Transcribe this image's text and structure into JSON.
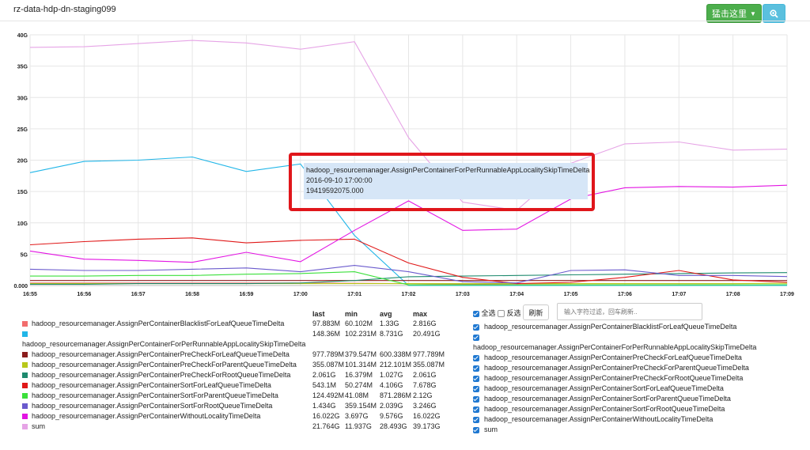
{
  "header": {
    "hostname": "rz-data-hdp-dn-staging099",
    "action_label": "猛击这里",
    "zoom_icon": "zoom-in-icon"
  },
  "chart_data": {
    "type": "line",
    "x": [
      "16:55",
      "16:56",
      "16:57",
      "16:58",
      "16:59",
      "17:00",
      "17:01",
      "17:02",
      "17:03",
      "17:04",
      "17:05",
      "17:06",
      "17:07",
      "17:08",
      "17:09"
    ],
    "y_ticks": [
      "0.000",
      "5G",
      "10G",
      "15G",
      "20G",
      "25G",
      "30G",
      "35G",
      "40G"
    ],
    "ylim": [
      0,
      40
    ],
    "y_unit": "G",
    "grid": true,
    "series": [
      {
        "name": "hadoop_resourcemanager.AssignPerContainerBlacklistForLeafQueueTimeDelta",
        "color": "#f26d6d",
        "values": [
          0.4,
          0.4,
          0.4,
          0.4,
          0.4,
          0.4,
          0.35,
          0.3,
          0.2,
          0.15,
          0.1,
          0.1,
          0.12,
          0.1,
          0.1
        ]
      },
      {
        "name": "hadoop_resourcemanager.AssignPerContainerForPerRunnableAppLocalitySkipTimeDelta",
        "color": "#21b6e8",
        "values": [
          18,
          19.8,
          20,
          20.5,
          18.2,
          19.4,
          8,
          0,
          0,
          0,
          0,
          0,
          0,
          0,
          0
        ]
      },
      {
        "name": "hadoop_resourcemanager.AssignPerContainerPreCheckForLeafQueueTimeDelta",
        "color": "#8b1c1c",
        "values": [
          0.8,
          0.8,
          0.8,
          0.8,
          0.8,
          0.8,
          0.8,
          0.8,
          0.8,
          0.8,
          0.8,
          0.8,
          0.8,
          0.8,
          0.8
        ]
      },
      {
        "name": "hadoop_resourcemanager.AssignPerContainerPreCheckForParentQueueTimeDelta",
        "color": "#b8c81a",
        "values": [
          0.3,
          0.3,
          0.3,
          0.3,
          0.3,
          0.3,
          0.3,
          0.3,
          0.3,
          0.3,
          0.3,
          0.3,
          0.3,
          0.3,
          0.35
        ]
      },
      {
        "name": "hadoop_resourcemanager.AssignPerContainerPreCheckForRootQueueTimeDelta",
        "color": "#1e8a6e",
        "values": [
          0.2,
          0.2,
          0.3,
          0.3,
          0.3,
          0.4,
          0.8,
          1.4,
          1.5,
          1.6,
          1.7,
          1.8,
          1.9,
          2,
          2.06
        ]
      },
      {
        "name": "hadoop_resourcemanager.AssignPerContainerSortForLeafQueueTimeDelta",
        "color": "#e01818",
        "values": [
          6.5,
          7,
          7.4,
          7.6,
          6.8,
          7.2,
          7.4,
          3.6,
          1.3,
          0.3,
          0.5,
          1.3,
          2.4,
          0.9,
          0.5
        ]
      },
      {
        "name": "hadoop_resourcemanager.AssignPerContainerSortForParentQueueTimeDelta",
        "color": "#3be03b",
        "values": [
          1.5,
          1.5,
          1.6,
          1.6,
          1.8,
          1.9,
          2.2,
          0.1,
          0.1,
          0.1,
          0.1,
          0.1,
          0.1,
          0.1,
          0.12
        ]
      },
      {
        "name": "hadoop_resourcemanager.AssignPerContainerSortForRootQueueTimeDelta",
        "color": "#6a5acd",
        "values": [
          2.6,
          2.4,
          2.4,
          2.6,
          2.8,
          2.2,
          3.2,
          2.2,
          0.6,
          0.4,
          2.4,
          2.5,
          1.6,
          1.6,
          1.43
        ]
      },
      {
        "name": "hadoop_resourcemanager.AssignPerContainerWithoutLocalityTimeDelta",
        "color": "#e314e3",
        "values": [
          5.5,
          4.2,
          4,
          3.7,
          5.3,
          3.8,
          8.8,
          13.5,
          8.8,
          9,
          13.8,
          15.6,
          15.8,
          15.7,
          16
        ]
      },
      {
        "name": "sum",
        "color": "#e6a4e6",
        "values": [
          38,
          38.1,
          38.6,
          39.1,
          38.7,
          37.7,
          38.9,
          23.6,
          13.3,
          12,
          19.5,
          22.6,
          22.9,
          21.6,
          21.76
        ]
      }
    ]
  },
  "tooltip": {
    "series": "hadoop_resourcemanager.AssignPerContainerForPerRunnableAppLocalitySkipTimeDelta",
    "time": "2016-09-10 17:00:00",
    "value": "19419592075.000"
  },
  "legend": {
    "headers": [
      "last",
      "min",
      "avg",
      "max"
    ],
    "rows": [
      {
        "name": "hadoop_resourcemanager.AssignPerContainerBlacklistForLeafQueueTimeDelta",
        "last": "97.883M",
        "min": "60.102M",
        "avg": "1.33G",
        "max": "2.816G"
      },
      {
        "name": "hadoop_resourcemanager.AssignPerContainerForPerRunnableAppLocalitySkipTimeDelta",
        "last": "148.36M",
        "min": "102.231M",
        "avg": "8.731G",
        "max": "20.491G"
      },
      {
        "name": "hadoop_resourcemanager.AssignPerContainerPreCheckForLeafQueueTimeDelta",
        "last": "977.789M",
        "min": "379.547M",
        "avg": "600.338M",
        "max": "977.789M"
      },
      {
        "name": "hadoop_resourcemanager.AssignPerContainerPreCheckForParentQueueTimeDelta",
        "last": "355.087M",
        "min": "101.314M",
        "avg": "212.101M",
        "max": "355.087M"
      },
      {
        "name": "hadoop_resourcemanager.AssignPerContainerPreCheckForRootQueueTimeDelta",
        "last": "2.061G",
        "min": "16.379M",
        "avg": "1.027G",
        "max": "2.061G"
      },
      {
        "name": "hadoop_resourcemanager.AssignPerContainerSortForLeafQueueTimeDelta",
        "last": "543.1M",
        "min": "50.274M",
        "avg": "4.106G",
        "max": "7.678G"
      },
      {
        "name": "hadoop_resourcemanager.AssignPerContainerSortForParentQueueTimeDelta",
        "last": "124.492M",
        "min": "41.08M",
        "avg": "871.286M",
        "max": "2.12G"
      },
      {
        "name": "hadoop_resourcemanager.AssignPerContainerSortForRootQueueTimeDelta",
        "last": "1.434G",
        "min": "359.154M",
        "avg": "2.039G",
        "max": "3.246G"
      },
      {
        "name": "hadoop_resourcemanager.AssignPerContainerWithoutLocalityTimeDelta",
        "last": "16.022G",
        "min": "3.697G",
        "avg": "9.576G",
        "max": "16.022G"
      },
      {
        "name": "sum",
        "last": "21.764G",
        "min": "11.937G",
        "avg": "28.493G",
        "max": "39.173G"
      }
    ]
  },
  "controls": {
    "select_all_label": "全选",
    "invert_label": "反选",
    "refresh_label": "刷新",
    "filter_placeholder": "输入字符过滤，回车刷新.."
  }
}
